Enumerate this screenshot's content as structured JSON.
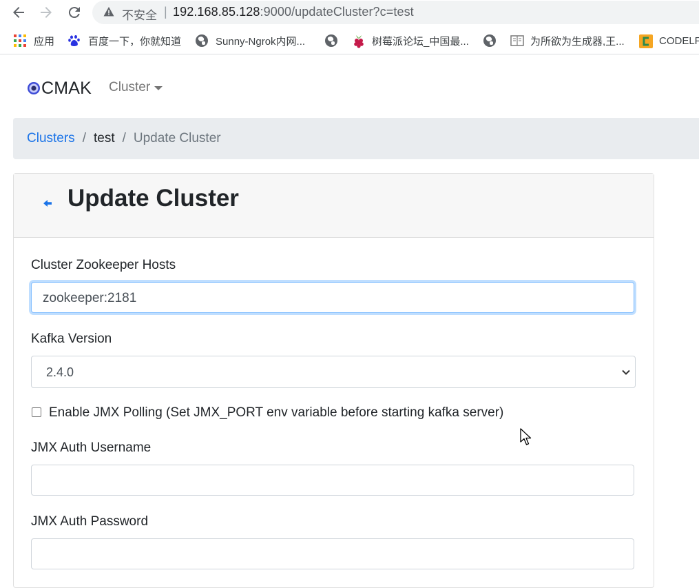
{
  "browser": {
    "security_text": "不安全",
    "separator": "|",
    "url_host": "192.168.85.128",
    "url_path": ":9000/updateCluster?c=test",
    "nav_icons": [
      "back-arrow-icon",
      "forward-arrow-icon",
      "reload-icon"
    ],
    "bookmarks": [
      {
        "label": "应用",
        "icon": "apps-grid-icon"
      },
      {
        "label": "百度一下，你就知道",
        "icon": "baidu-paw-icon"
      },
      {
        "label": "Sunny-Ngrok内网...",
        "icon": "globe-icon"
      },
      {
        "label": "",
        "icon": "globe-icon"
      },
      {
        "label": "树莓派论坛_中国最...",
        "icon": "raspberry-icon"
      },
      {
        "label": "",
        "icon": "globe-icon"
      },
      {
        "label": "为所欲为生成器,王...",
        "icon": "book-icon"
      },
      {
        "label": "CODELF",
        "icon": "codelf-icon"
      }
    ]
  },
  "navbar": {
    "brand": "CMAK",
    "cluster_menu": "Cluster"
  },
  "breadcrumb": {
    "clusters": "Clusters",
    "separator": "/",
    "cluster_name": "test",
    "current": "Update Cluster"
  },
  "form": {
    "title": "Update Cluster",
    "zk_label": "Cluster Zookeeper Hosts",
    "zk_value": "zookeeper:2181",
    "kafka_label": "Kafka Version",
    "kafka_value": "2.4.0",
    "jmx_checkbox_label": "Enable JMX Polling (Set JMX_PORT env variable before starting kafka server)",
    "jmx_checked": false,
    "jmx_user_label": "JMX Auth Username",
    "jmx_user_value": "",
    "jmx_pass_label": "JMX Auth Password",
    "jmx_pass_value": ""
  },
  "colors": {
    "link": "#1a73e8",
    "breadcrumb_bg": "#e9ecef",
    "focus_border": "#80bdff",
    "card_header_bg": "#f7f7f7"
  }
}
